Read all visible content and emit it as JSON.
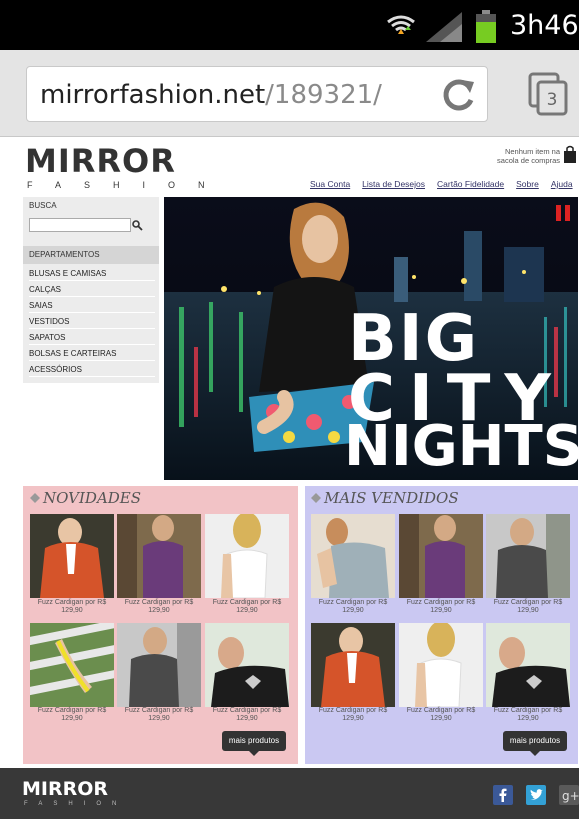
{
  "status_bar": {
    "time": "3h46"
  },
  "browser": {
    "url_host": "mirrorfashion.net",
    "url_path": "/189321/",
    "tab_count": "3"
  },
  "header": {
    "logo": "MIRROR",
    "logo_sub": "FASHION",
    "cart_line1": "Nenhum item na",
    "cart_line2": "sacola de compras"
  },
  "topnav": [
    "Sua Conta",
    "Lista de Desejos",
    "Cartão Fidelidade",
    "Sobre",
    "Ajuda"
  ],
  "sidebar": {
    "search_label": "BUSCA",
    "departments_title": "DEPARTAMENTOS",
    "departments": [
      "BLUSAS E CAMISAS",
      "CALÇAS",
      "SAIAS",
      "VESTIDOS",
      "SAPATOS",
      "BOLSAS E CARTEIRAS",
      "ACESSÓRIOS"
    ]
  },
  "banner": {
    "line1": "BIG",
    "line2": "CITY",
    "line3": "NIGHTS"
  },
  "novidades": {
    "title": "NOVIDADES",
    "caption": "Fuzz Cardigan por R$",
    "price": "129,90",
    "more": "mais produtos"
  },
  "mais_vendidos": {
    "title": "MAIS VENDIDOS",
    "caption": "Fuzz Cardigan por R$",
    "price": "129,90",
    "more": "mais produtos"
  },
  "footer": {
    "logo": "MIRROR",
    "logo_sub": "FASHION"
  },
  "colors": {
    "novidades_bg": "#f2c3c6",
    "mais_bg": "#cac8f2",
    "footer_bg": "#383838"
  }
}
